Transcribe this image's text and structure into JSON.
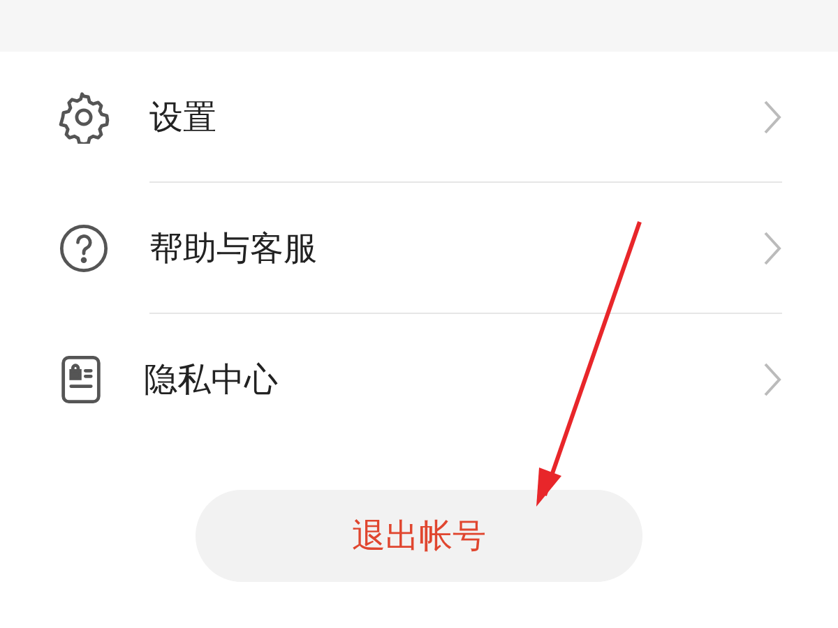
{
  "menu_items": [
    {
      "kind": "settings",
      "label": "设置"
    },
    {
      "kind": "help",
      "label": "帮助与客服"
    },
    {
      "kind": "privacy",
      "label": "隐私中心"
    }
  ],
  "logout_button": "退出帐号"
}
